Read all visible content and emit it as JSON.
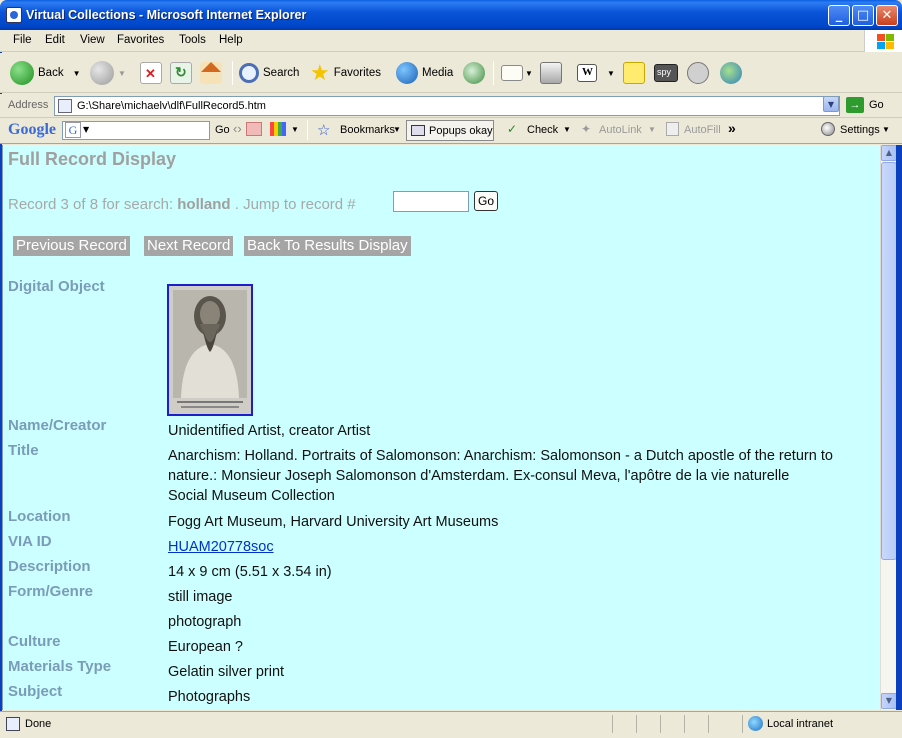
{
  "window": {
    "title": "Virtual Collections - Microsoft Internet Explorer",
    "min": "_",
    "max": "□",
    "close": "✕"
  },
  "menu": {
    "items": [
      "File",
      "Edit",
      "View",
      "Favorites",
      "Tools",
      "Help"
    ]
  },
  "toolbar": {
    "back": "Back",
    "search": "Search",
    "favorites": "Favorites",
    "media": "Media"
  },
  "address": {
    "label": "Address",
    "value": "G:\\Share\\michaelv\\dlf\\FullRecord5.htm",
    "go": "Go"
  },
  "googlebar": {
    "logo": "Google",
    "go": "Go",
    "bookmarks": "Bookmarks",
    "popups": "Popups okay",
    "check": "Check",
    "autolink": "AutoLink",
    "autofill": "AutoFill",
    "more": "»",
    "settings": "Settings"
  },
  "page": {
    "title": "Full Record Display",
    "record_prefix": "Record 3 of 8  for search: ",
    "search_term": "holland",
    "record_suffix": " .  Jump to record #",
    "go_button": "Go",
    "nav": {
      "previous": "Previous Record",
      "next": "Next Record",
      "back": "Back To Results Display"
    },
    "fields": {
      "digital_object_label": "Digital Object",
      "name_creator_label": "Name/Creator",
      "name_creator_value": "Unidentified Artist,  creator Artist",
      "title_label": "Title",
      "title_value_1": "Anarchism: Holland. Portraits of Salomonson: Anarchism: Salomonson - a Dutch apostle of the return to nature.: Monsieur Joseph Salomonson d'Amsterdam. Ex-consul Meva, l'apôtre de la vie naturelle",
      "title_value_2": "Social Museum Collection",
      "location_label": "Location",
      "location_value": "Fogg Art Museum, Harvard University Art Museums",
      "via_id_label": "VIA ID",
      "via_id_value": "HUAM20778soc",
      "description_label": "Description",
      "description_value": "14 x 9 cm (5.51 x 3.54 in)",
      "form_genre_label": "Form/Genre",
      "form_genre_value_1": "still image",
      "form_genre_value_2": "photograph",
      "culture_label": "Culture",
      "culture_value": "European ?",
      "materials_label": "Materials Type",
      "materials_value": "Gelatin silver print",
      "subject_label": "Subject",
      "subject_value": "Photographs"
    }
  },
  "status": {
    "text": "Done",
    "zone": "Local intranet"
  }
}
